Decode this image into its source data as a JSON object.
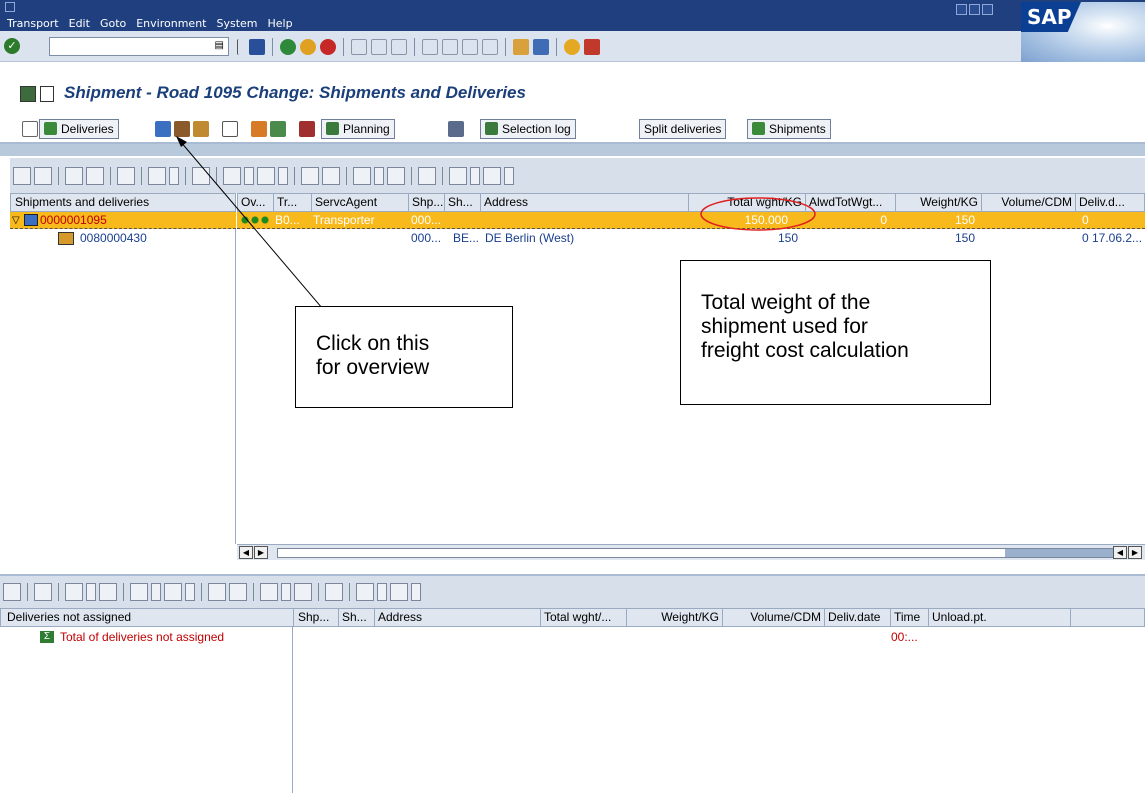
{
  "menubar": {
    "items": [
      "Transport",
      "Edit",
      "Goto",
      "Environment",
      "System",
      "Help"
    ]
  },
  "sap_logo": "SAP",
  "title": "Shipment - Road 1095 Change: Shipments and Deliveries",
  "app_toolbar": {
    "deliveries": "Deliveries",
    "planning": "Planning",
    "selection_log": "Selection log",
    "split_deliveries": "Split deliveries",
    "shipments": "Shipments"
  },
  "upper": {
    "tree_header": "Shipments and deliveries",
    "columns": [
      "Ov...",
      "Tr...",
      "ServcAgent",
      "Shp...",
      "Sh...",
      "Address",
      "Total wght/KG",
      "AlwdTotWgt...",
      "Weight/KG",
      "Volume/CDM",
      "Deliv.d..."
    ],
    "row_shipment": {
      "id": "0000001095",
      "tr": "B0...",
      "agent": "Transporter",
      "shp": "000...",
      "total": "150.000",
      "allowed": "0",
      "weight": "150",
      "volume": "0"
    },
    "row_delivery": {
      "id": "0080000430",
      "shp": "000...",
      "sh": "BE...",
      "address": "DE  Berlin (West)",
      "total": "150",
      "weight": "150",
      "volume": "0",
      "date": "17.06.2..."
    }
  },
  "lower": {
    "tree_header": "Deliveries not assigned",
    "columns": [
      "Shp...",
      "Sh...",
      "Address",
      "Total wght/...",
      "Weight/KG",
      "Volume/CDM",
      "Deliv.date",
      "Time",
      "Unload.pt."
    ],
    "total_label": "Total of deliveries not assigned",
    "time_value": "00:..."
  },
  "annotations": {
    "click_overview": [
      "Click on this",
      "for overview"
    ],
    "total_weight": [
      "Total weight of the",
      "shipment used for",
      "freight cost calculation"
    ]
  },
  "colors": {
    "menubar": "#1f3f7e",
    "highlight_row": "#f7b91c",
    "annotation_circle": "#e02020"
  }
}
